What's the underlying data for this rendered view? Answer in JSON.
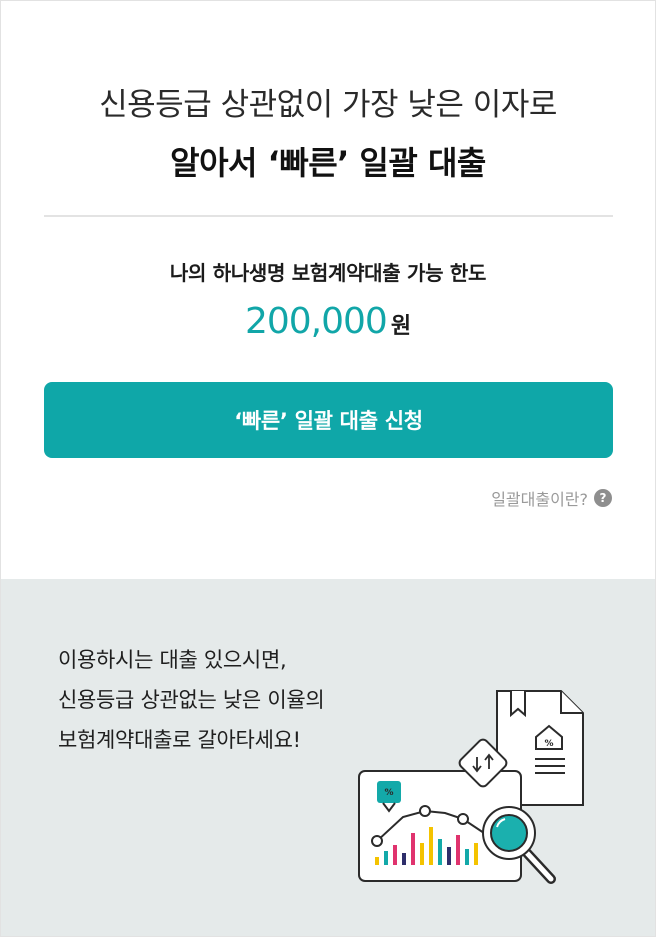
{
  "hero": {
    "line1": "신용등급 상관없이 가장 낮은 이자로",
    "line2": "알아서 ‘빠른’ 일괄 대출"
  },
  "limit": {
    "label": "나의 하나생명 보험계약대출 가능 한도",
    "amount": "200,000",
    "unit": "원"
  },
  "apply_button": {
    "label": "‘빠른’ 일괄 대출 신청"
  },
  "help_link": {
    "label": "일괄대출이란?",
    "icon": "question-circle-icon",
    "icon_glyph": "?"
  },
  "promo": {
    "lines": [
      "이용하시는 대출 있으시면,",
      "신용등급 상관없는 낮은 이율의",
      "보험계약대출로 갈아타세요!"
    ]
  },
  "illustration": {
    "doc_badge": "%",
    "chart_badge": "%",
    "swap_icon": "↓↑"
  },
  "colors": {
    "accent": "#0fa7a8",
    "panel_bg": "#e5eaea",
    "bar_yellow": "#f4c300",
    "bar_teal": "#13a9a9",
    "bar_pink": "#e0336e",
    "bar_navy": "#2e2e6b",
    "lens": "#1bb0ae"
  }
}
